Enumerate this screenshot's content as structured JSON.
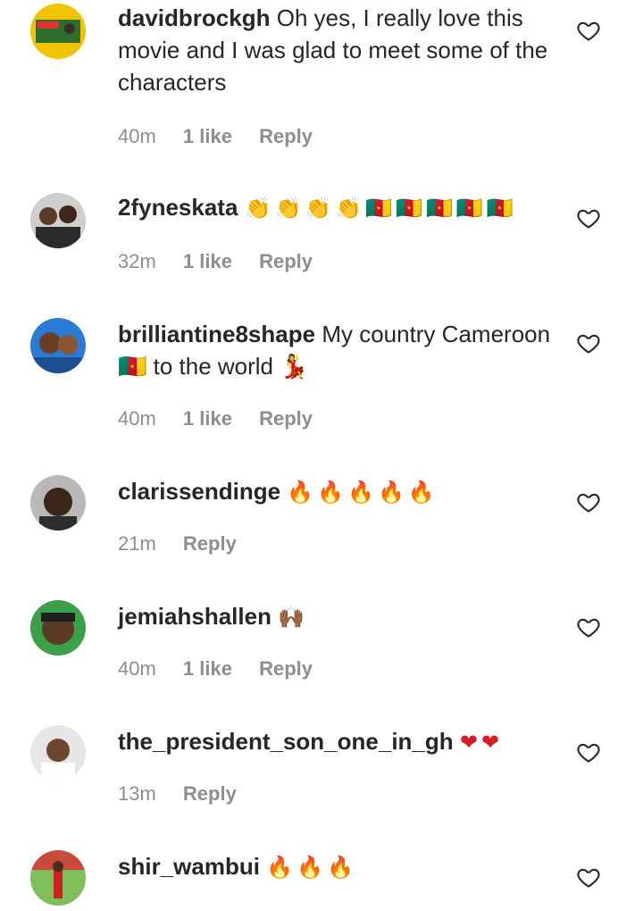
{
  "comments": [
    {
      "username": "davidbrockgh",
      "text": "Oh yes, I really love this movie and I was glad to meet some of the characters",
      "emoji": "",
      "time": "40m",
      "likes": "1 like",
      "reply": "Reply"
    },
    {
      "username": "2fyneskata",
      "text": "",
      "emoji": "👏👏👏👏🇨🇲🇨🇲🇨🇲🇨🇲🇨🇲",
      "time": "32m",
      "likes": "1 like",
      "reply": "Reply"
    },
    {
      "username": "brilliantine8shape",
      "text": "My country Cameroon 🇨🇲 to the world 💃",
      "emoji": "",
      "time": "40m",
      "likes": "1 like",
      "reply": "Reply"
    },
    {
      "username": "clarissendinge",
      "text": "",
      "emoji": "🔥🔥🔥🔥🔥",
      "time": "21m",
      "likes": "",
      "reply": "Reply"
    },
    {
      "username": "jemiahshallen",
      "text": "",
      "emoji": "🙌🏾",
      "time": "40m",
      "likes": "1 like",
      "reply": "Reply"
    },
    {
      "username": "the_president_son_one_in_gh",
      "text": "",
      "emoji": "❤❤",
      "time": "13m",
      "likes": "",
      "reply": "Reply"
    },
    {
      "username": "shir_wambui",
      "text": "",
      "emoji": "🔥🔥🔥",
      "time": "",
      "likes": "",
      "reply": ""
    }
  ],
  "colors": {
    "text": "#262626",
    "meta": "#8e8e8e",
    "background": "#ffffff"
  },
  "icons": {
    "like": "heart-outline-icon"
  }
}
